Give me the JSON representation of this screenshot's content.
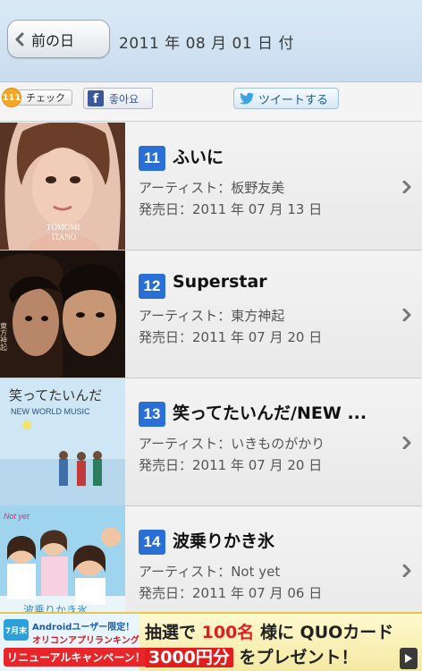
{
  "header": {
    "back_label": "前の日",
    "date": "2011 年 08 月 01 日 付"
  },
  "social": {
    "check_count": "111",
    "check_label": "チェック",
    "fb_icon": "f",
    "fb_label": "좋아요",
    "tweet_label": "ツイートする"
  },
  "chart": [
    {
      "rank": "11",
      "title": "ふいに",
      "artist": "アーティスト：板野友美",
      "release": "発売日：2011 年 07 月 13 日",
      "cover_text_1": "TOMOMI",
      "cover_text_2": "ITANO"
    },
    {
      "rank": "12",
      "title": "Superstar",
      "artist": "アーティスト：東方神起",
      "release": "発売日：2011 年 07 月 20 日",
      "cover_text_1": "東方神起"
    },
    {
      "rank": "13",
      "title": "笑ってたいんだ/NEW ...",
      "artist": "アーティスト：いきものがかり",
      "release": "発売日：2011 年 07 月 20 日",
      "cover_text_1": "笑ってたいんだ",
      "cover_text_2": "NEW WORLD MUSIC"
    },
    {
      "rank": "14",
      "title": "波乗りかき氷",
      "artist": "アーティスト：Not yet",
      "release": "発売日：2011 年 07 月 06 日",
      "cover_text_1": "Not yet",
      "cover_text_2": "波乗りかき氷"
    }
  ],
  "ad": {
    "month": "7月末",
    "line1": "Androidユーザー限定！",
    "line2": "オリコンアプリランキング",
    "line3": "リニューアルキャンペーン！",
    "lottery_pre": "抽選で",
    "lottery_num": "100名",
    "lottery_post": "様に QUOカード",
    "prize_amount": "3000円分",
    "prize_post": "をプレゼント！"
  },
  "colors": {
    "rank_badge": "#2a6fd6",
    "header_bg": "#d3e4f3",
    "facebook": "#3b5998"
  }
}
